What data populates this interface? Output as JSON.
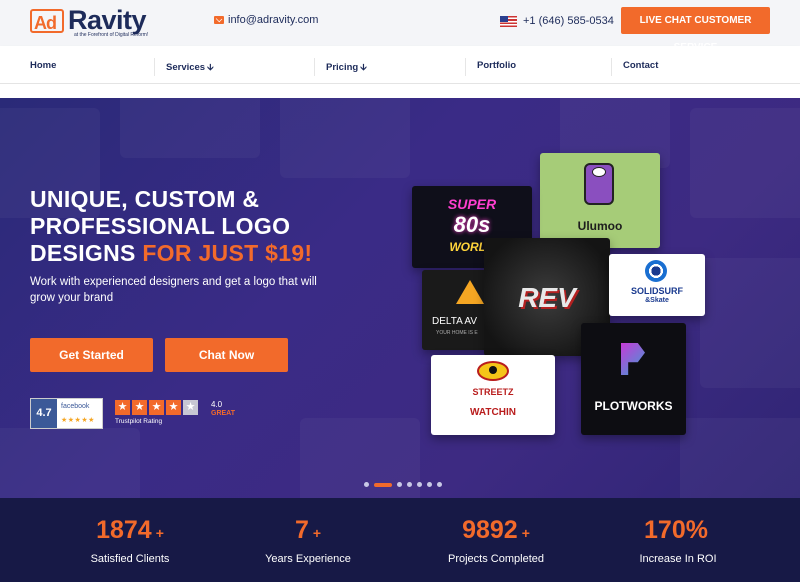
{
  "header": {
    "logo_ad": "Ad",
    "logo_ravity": "Ravity",
    "logo_tagline": "at the Forefront of Digital Reform!",
    "email": "info@adravity.com",
    "phone": "+1 (646) 585-0534",
    "live_chat_label": "LIVE CHAT CUSTOMER SERVICE"
  },
  "nav": {
    "items": [
      {
        "label": "Home"
      },
      {
        "label": "Services"
      },
      {
        "label": "Pricing"
      },
      {
        "label": "Portfolio"
      },
      {
        "label": "Contact"
      }
    ]
  },
  "hero": {
    "title_line1": "UNIQUE, CUSTOM &",
    "title_line2": "PROFESSIONAL LOGO",
    "title_line3_a": "DESIGNS ",
    "title_line3_b": "FOR JUST $19!",
    "subtitle": "Work with experienced designers and get a logo that will grow your brand",
    "get_started_label": "Get Started",
    "chat_now_label": "Chat Now",
    "facebook": {
      "score": "4.7",
      "label": "facebook"
    },
    "trustpilot": {
      "score": "4.0",
      "rating_word": "GREAT",
      "label": "Trustpilot Rating",
      "stars": 4
    }
  },
  "portfolio": {
    "cards": [
      {
        "name": "Super 80s World",
        "line1": "SUPER",
        "line2": "80s",
        "line3": "WORLD"
      },
      {
        "name": "Ulumoo",
        "text": "Ulumoo"
      },
      {
        "name": "Delta",
        "text": "DELTA AV",
        "subtext": "YOUR HOME IS E"
      },
      {
        "name": "Rev",
        "text": "REV"
      },
      {
        "name": "SolidSurf",
        "line1": "SOLIDSURF",
        "line2": "&Skate"
      },
      {
        "name": "Streetz Watchin",
        "line1": "STREETZ",
        "line2": "WATCHIN"
      },
      {
        "name": "Plotworks",
        "text": "PLOTWORKS"
      }
    ]
  },
  "carousel": {
    "dot_count": 7,
    "active_index": 1
  },
  "stats": [
    {
      "value": "1874",
      "plus": "+",
      "label": "Satisfied Clients"
    },
    {
      "value": "7",
      "plus": "+",
      "label": "Years Experience"
    },
    {
      "value": "9892",
      "plus": "+",
      "label": "Projects Completed"
    },
    {
      "value": "170%",
      "plus": "",
      "label": "Increase In ROI"
    }
  ],
  "colors": {
    "accent": "#f26a2b",
    "navy": "#1d2b5a",
    "hero_bg": "#3a2b86",
    "stats_bg": "#171946"
  }
}
